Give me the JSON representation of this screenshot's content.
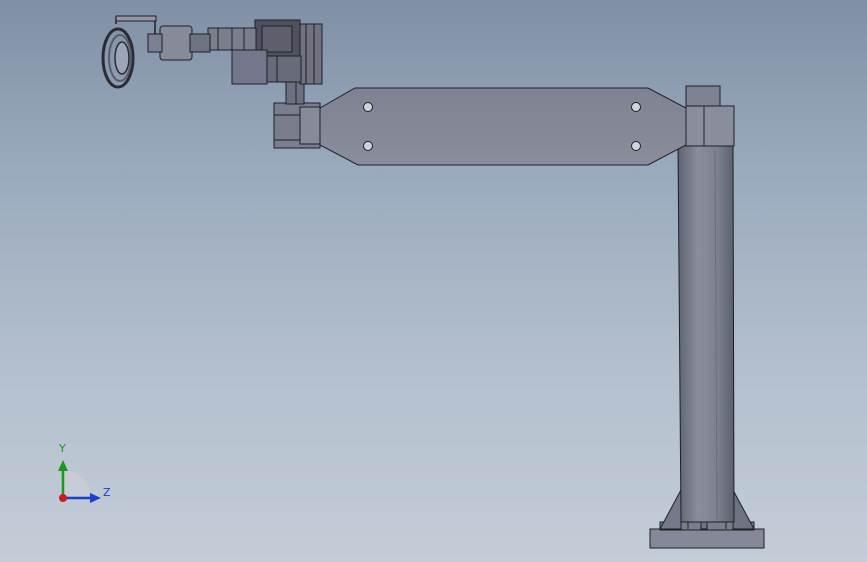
{
  "viewport": {
    "triad": {
      "y_label": "Y",
      "z_label": "Z",
      "y_color": "#1a9a1a",
      "z_color": "#1a3fd0",
      "x_color": "#d01a1a"
    }
  },
  "colors": {
    "part_fill": "#808495",
    "part_shadow": "#6d7080",
    "part_dark": "#4a4c57",
    "edge": "#1e1f26",
    "background_top": "#7f90a6",
    "background_bottom": "#c3cdd8"
  }
}
